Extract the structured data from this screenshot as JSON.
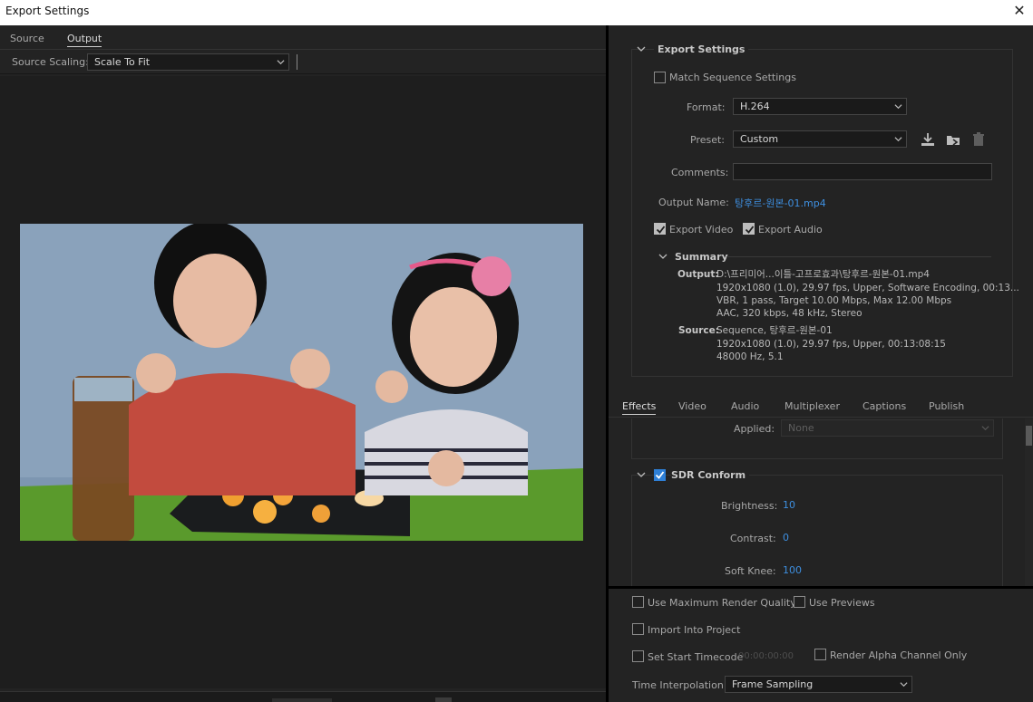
{
  "window": {
    "title": "Export Settings",
    "close_icon": "close-icon"
  },
  "left": {
    "tabs": [
      {
        "label": "Source",
        "active": false
      },
      {
        "label": "Output",
        "active": true
      }
    ],
    "source_scaling_label": "Source Scaling:",
    "source_scaling_value": "Scale To Fit"
  },
  "export_settings": {
    "header": "Export Settings",
    "match_sequence_label": "Match Sequence Settings",
    "match_sequence_checked": false,
    "format_label": "Format:",
    "format_value": "H.264",
    "preset_label": "Preset:",
    "preset_value": "Custom",
    "comments_label": "Comments:",
    "comments_value": "",
    "output_name_label": "Output Name:",
    "output_name_value": "탕후르-원본-01.mp4",
    "export_video_label": "Export Video",
    "export_video_checked": true,
    "export_audio_label": "Export Audio",
    "export_audio_checked": true
  },
  "summary": {
    "header": "Summary",
    "output_label": "Output:",
    "output_lines": [
      "D:\\프리미어...이틀-고프로효과\\탕후르-원본-01.mp4",
      "1920x1080 (1.0), 29.97 fps, Upper, Software Encoding, 00:13...",
      "VBR, 1 pass, Target 10.00 Mbps, Max 12.00 Mbps",
      "AAC, 320 kbps, 48 kHz, Stereo"
    ],
    "source_label": "Source:",
    "source_lines": [
      "Sequence, 탕후르-원본-01",
      "1920x1080 (1.0), 29.97 fps, Upper, 00:13:08:15",
      "48000 Hz, 5.1"
    ]
  },
  "settings_tabs": [
    {
      "label": "Effects",
      "active": true
    },
    {
      "label": "Video",
      "active": false
    },
    {
      "label": "Audio",
      "active": false
    },
    {
      "label": "Multiplexer",
      "active": false
    },
    {
      "label": "Captions",
      "active": false
    },
    {
      "label": "Publish",
      "active": false
    }
  ],
  "effects": {
    "applied_label": "Applied:",
    "applied_value": "None",
    "sdr_conform_label": "SDR Conform",
    "sdr_conform_checked": true,
    "brightness_label": "Brightness:",
    "brightness_value": "10",
    "contrast_label": "Contrast:",
    "contrast_value": "0",
    "soft_knee_label": "Soft Knee:",
    "soft_knee_value": "100"
  },
  "bottom": {
    "max_render_label": "Use Maximum Render Quality",
    "use_previews_label": "Use Previews",
    "import_project_label": "Import Into Project",
    "start_timecode_label": "Set Start Timecode",
    "start_timecode_value": "00:00:00:00",
    "render_alpha_label": "Render Alpha Channel Only",
    "time_interp_label": "Time Interpolation:",
    "time_interp_value": "Frame Sampling"
  },
  "colors": {
    "accent": "#3e8fe0",
    "panel": "#232323",
    "checkbox_blue": "#2e7fd6"
  }
}
